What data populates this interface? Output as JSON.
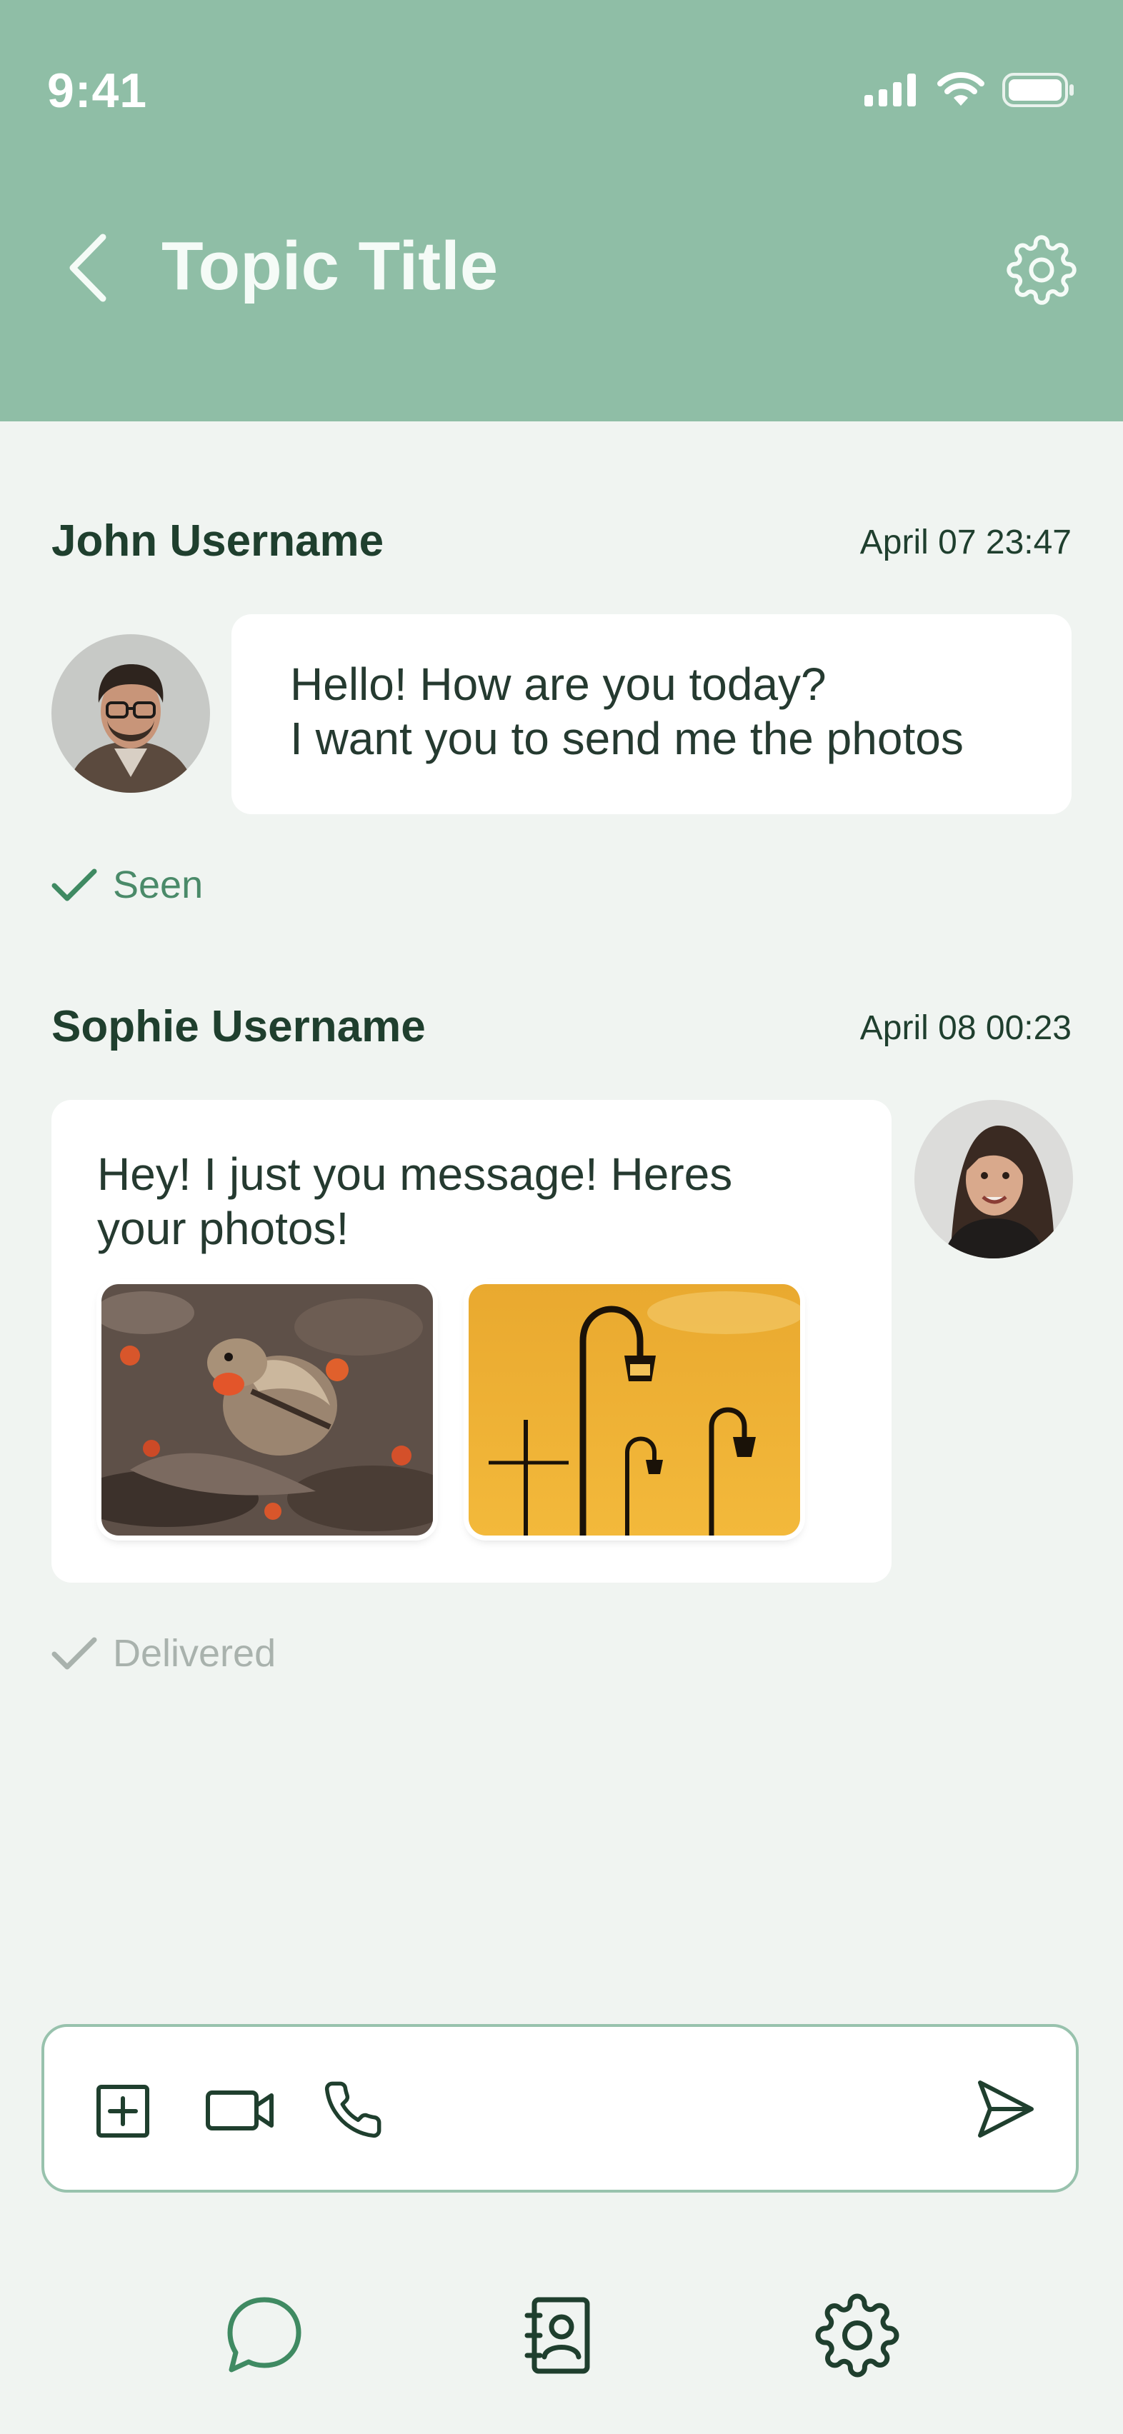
{
  "status_bar": {
    "time": "9:41"
  },
  "header": {
    "title": "Topic Title"
  },
  "messages": [
    {
      "sender": "John Username",
      "date": "April 07",
      "time": "23:47",
      "lines": [
        "Hello! How are you today?",
        "I want you to send me the photos"
      ],
      "status": "Seen"
    },
    {
      "sender": "Sophie Username",
      "date": "April 08",
      "time": "00:23",
      "lines": [
        "Hey! I just you message! Heres",
        "your photos!"
      ],
      "status": "Delivered"
    }
  ],
  "composer": {
    "icons": [
      "add-square-icon",
      "video-camera-icon",
      "phone-icon",
      "send-icon"
    ]
  },
  "bottom_nav": {
    "icons": [
      "chat-bubble-icon",
      "contacts-book-icon",
      "settings-gear-icon"
    ]
  },
  "colors": {
    "header_bg": "#8fbea6",
    "page_bg": "#f0f4f1",
    "accent": "#3f8a62",
    "text_dark": "#1f3f2e",
    "delivered_gray": "#a9b2ad"
  }
}
